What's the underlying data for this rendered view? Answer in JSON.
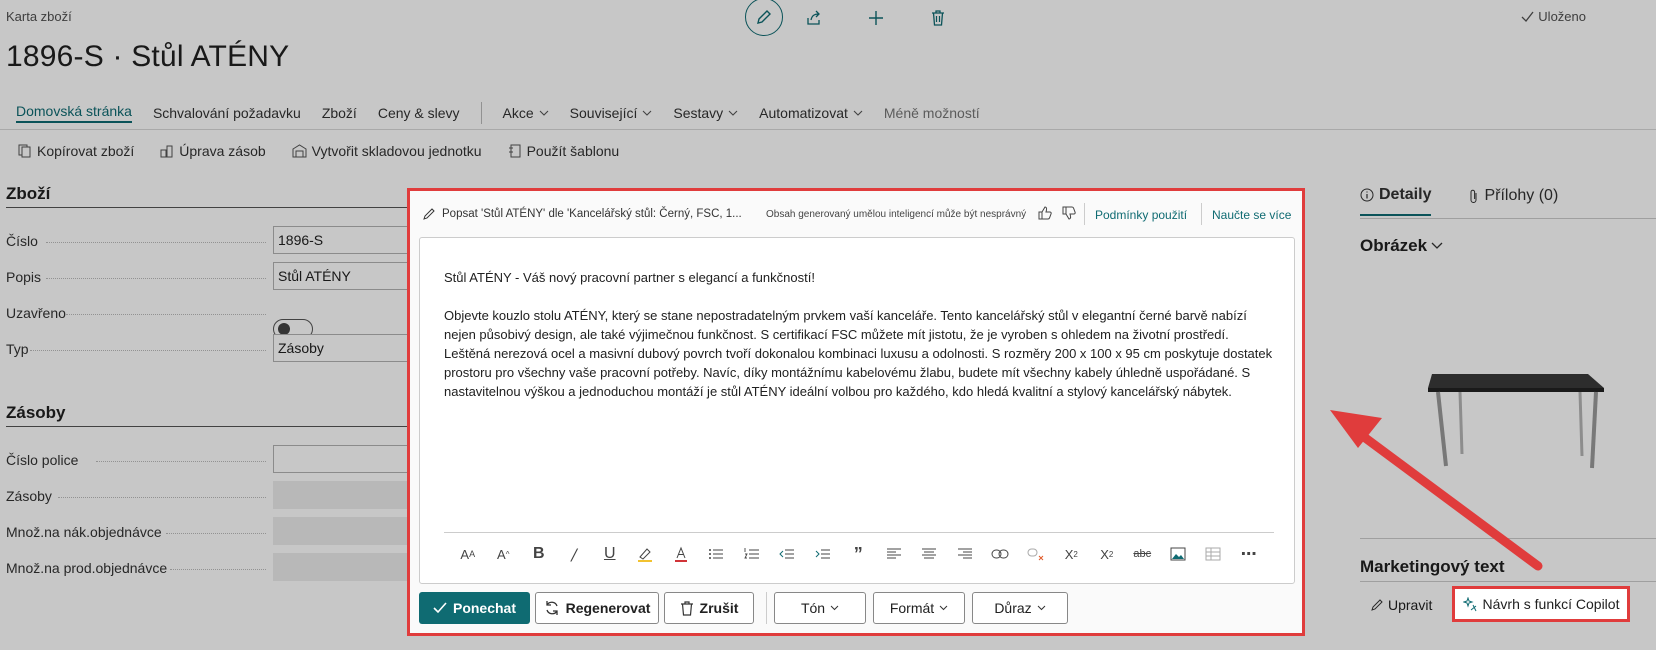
{
  "breadcrumb": "Karta zboží",
  "title": "1896-S · Stůl ATÉNY",
  "status": "Uloženo",
  "nav": {
    "items": [
      "Domovská stránka",
      "Schvalování požadavku",
      "Zboží",
      "Ceny & slevy"
    ],
    "dropdowns": [
      "Akce",
      "Související",
      "Sestavy",
      "Automatizovat"
    ],
    "less": "Méně možností"
  },
  "toolbar": [
    "Kopírovat zboží",
    "Úprava zásob",
    "Vytvořit skladovou jednotku",
    "Použít šablonu"
  ],
  "item_section": {
    "title": "Zboží",
    "fields": [
      {
        "label": "Číslo",
        "value": "1896-S"
      },
      {
        "label": "Popis",
        "value": "Stůl ATÉNY"
      },
      {
        "label": "Uzavřeno",
        "value": ""
      },
      {
        "label": "Typ",
        "value": "Zásoby"
      }
    ]
  },
  "inventory_section": {
    "title": "Zásoby",
    "fields": [
      {
        "label": "Číslo police",
        "value": ""
      },
      {
        "label": "Zásoby",
        "value": ""
      },
      {
        "label": "Množ.na nák.objednávce",
        "value": ""
      },
      {
        "label": "Množ.na prod.objednávce",
        "value": ""
      }
    ]
  },
  "right_pane": {
    "tabs": [
      "Detaily",
      "Přílohy (0)"
    ],
    "picture_title": "Obrázek",
    "marketing_title": "Marketingový text",
    "edit_label": "Upravit",
    "copilot_label": "Návrh s funkcí Copilot"
  },
  "copilot": {
    "header": "Popsat 'Stůl ATÉNY' dle 'Kancelářský stůl: Černý, FSC, 1...",
    "disclaimer": "Obsah generovaný umělou inteligencí může být nesprávný",
    "terms": "Podmínky použití",
    "learn": "Naučte se více",
    "text_heading": "Stůl ATÉNY - Váš nový pracovní partner s elegancí a funkčností!",
    "text_body": "Objevte kouzlo stolu ATÉNY, který se stane nepostradatelným prvkem vaší kanceláře. Tento kancelářský stůl v elegantní černé barvě nabízí nejen působivý design, ale také výjimečnou funkčnost. S certifikací FSC můžete mít jistotu, že je vyroben s ohledem na životní prostředí. Leštěná nerezová ocel a masivní dubový povrch tvoří dokonalou kombinaci luxusu a odolnosti. S rozměry 200 x 100 x 95 cm poskytuje dostatek prostoru pro všechny vaše pracovní potřeby. Navíc, díky montážnímu kabelovému žlabu, budete mít všechny kabely úhledně uspořádané. S nastavitelnou výškou a jednoduchou montáží je stůl ATÉNY ideální volbou pro každého, kdo hledá kvalitní a stylový kancelářský nábytek.",
    "keep": "Ponechat",
    "regenerate": "Regenerovat",
    "cancel": "Zrušit",
    "tone": "Tón",
    "format": "Formát",
    "emphasis": "Důraz"
  },
  "colors": {
    "accent": "#0f6b72",
    "highlight": "#e03c3c"
  }
}
